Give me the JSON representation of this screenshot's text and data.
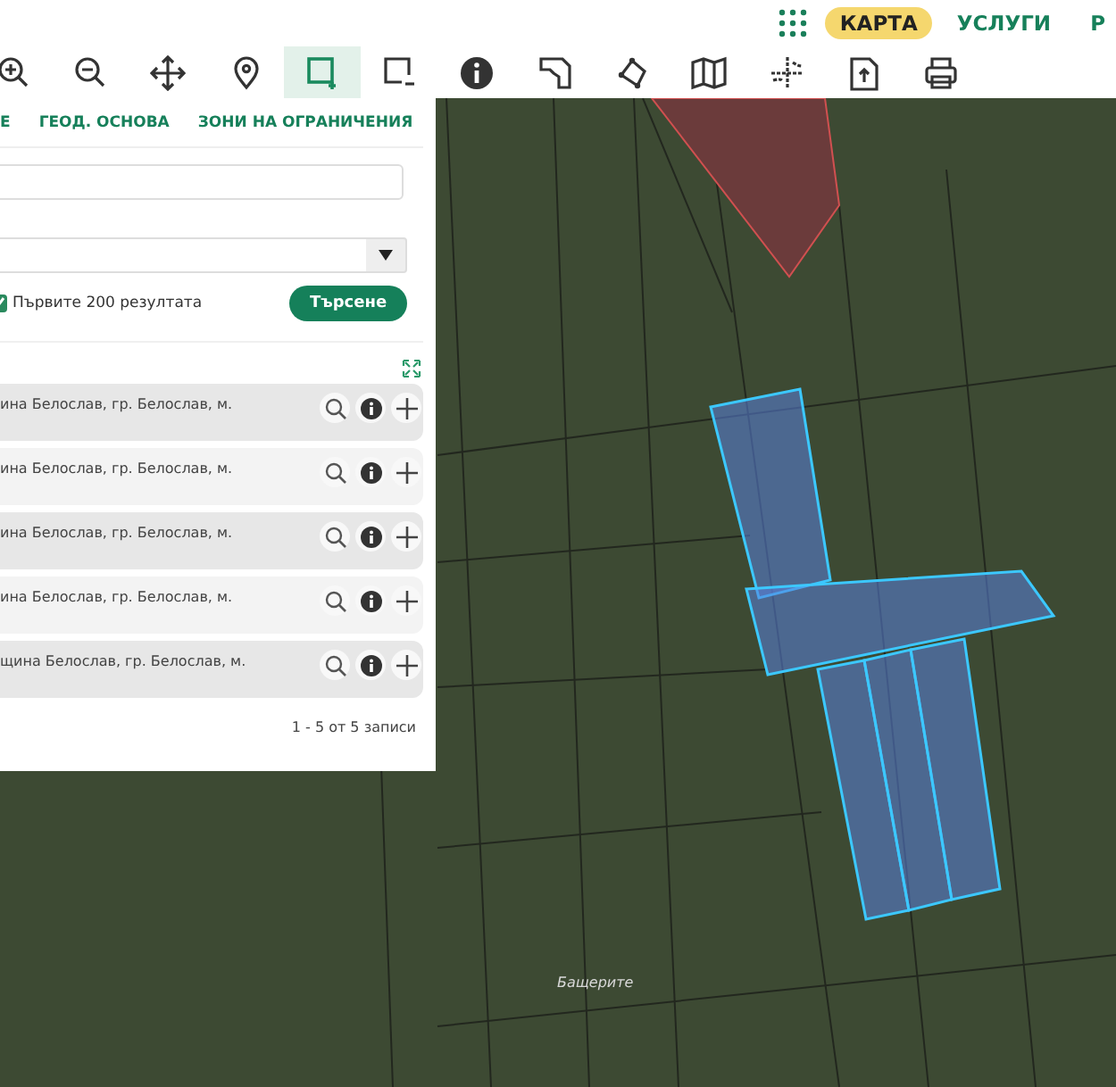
{
  "header": {
    "nav": [
      {
        "label": "КАРТА",
        "selected": true
      },
      {
        "label": "УСЛУГИ",
        "selected": false
      },
      {
        "label": "Р",
        "selected": false
      }
    ]
  },
  "toolbar": [
    {
      "kind": "zoom-in",
      "selected": false
    },
    {
      "kind": "zoom-out",
      "selected": false
    },
    {
      "kind": "pan",
      "selected": false
    },
    {
      "kind": "pin",
      "selected": false
    },
    {
      "kind": "select-add",
      "selected": true
    },
    {
      "kind": "select-remove",
      "selected": false
    },
    {
      "kind": "info",
      "selected": false
    },
    {
      "kind": "measure",
      "selected": false
    },
    {
      "kind": "polygon",
      "selected": false
    },
    {
      "kind": "map",
      "selected": false
    },
    {
      "kind": "crosshair",
      "selected": false
    },
    {
      "kind": "export",
      "selected": false
    },
    {
      "kind": "print",
      "selected": false
    }
  ],
  "panel": {
    "tabs": [
      {
        "label": "Е",
        "selected": false
      },
      {
        "label": "ГЕОД. ОСНОВА",
        "selected": false
      },
      {
        "label": "ЗОНИ НА ОГРАНИЧЕНИЯ",
        "selected": false
      }
    ],
    "limit_checkbox": {
      "label": "Първите 200 резултата",
      "checked": true
    },
    "search_button": "Търсене",
    "results": [
      {
        "text": "ина Белослав, гр. Белослав, м."
      },
      {
        "text": "ина Белослав, гр. Белослав, м."
      },
      {
        "text": "ина Белослав, гр. Белослав, м."
      },
      {
        "text": "ина Белослав, гр. Белослав, м."
      },
      {
        "text": "щина Белослав, гр. Белослав, м."
      }
    ],
    "pagination": "1 - 5 от 5 записи"
  },
  "map": {
    "place_label": "Бащерите"
  }
}
